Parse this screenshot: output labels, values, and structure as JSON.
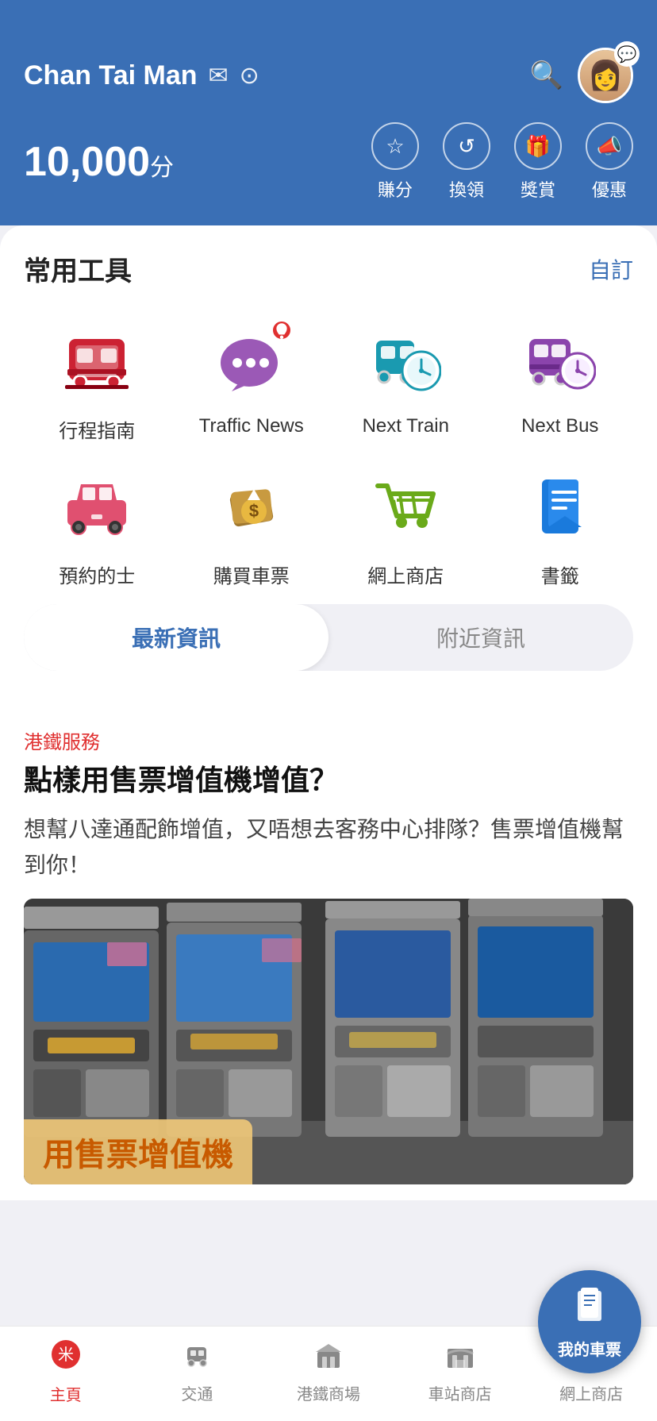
{
  "header": {
    "username": "Chan Tai Man",
    "points": "10,000",
    "points_unit": "分",
    "search_label": "search",
    "avatar_emoji": "👩"
  },
  "quick_actions": [
    {
      "id": "earn",
      "icon": "☆",
      "label": "賺分"
    },
    {
      "id": "redeem",
      "icon": "↺",
      "label": "換領"
    },
    {
      "id": "rewards",
      "icon": "🎁",
      "label": "獎賞"
    },
    {
      "id": "offers",
      "icon": "📣",
      "label": "優惠"
    }
  ],
  "tools_section": {
    "title": "常用工具",
    "customize_label": "自訂"
  },
  "tools": [
    {
      "id": "journey",
      "label": "行程指南",
      "color": "#cc2233"
    },
    {
      "id": "traffic-news",
      "label": "Traffic News",
      "color": "#9b59b6"
    },
    {
      "id": "next-train",
      "label": "Next Train",
      "color": "#1a9ab0"
    },
    {
      "id": "next-bus",
      "label": "Next Bus",
      "color": "#8b44ac"
    },
    {
      "id": "taxi",
      "label": "預約的士",
      "color": "#e05070"
    },
    {
      "id": "buy-ticket",
      "label": "購買車票",
      "color": "#8b6914"
    },
    {
      "id": "online-shop",
      "label": "網上商店",
      "color": "#6aaa1a"
    },
    {
      "id": "bookmarks",
      "label": "書籤",
      "color": "#1a7adc"
    }
  ],
  "tabs": [
    {
      "id": "latest",
      "label": "最新資訊",
      "active": true
    },
    {
      "id": "nearby",
      "label": "附近資訊",
      "active": false
    }
  ],
  "news": {
    "category": "港鐵服務",
    "title": "點樣用售票增值機增值？",
    "description": "想幫八達通配飾增值，又唔想去客務中心排隊？售票增值機幫到你！",
    "image_text": "用售票增值機"
  },
  "bottom_nav": [
    {
      "id": "home",
      "label": "主頁",
      "active": true,
      "icon": "⊗"
    },
    {
      "id": "transport",
      "label": "交通",
      "active": false,
      "icon": "🚇"
    },
    {
      "id": "mtr-mall",
      "label": "港鐵商場",
      "active": false,
      "icon": "🏬"
    },
    {
      "id": "station-shop",
      "label": "車站商店",
      "active": false,
      "icon": "🏪"
    },
    {
      "id": "online-shop",
      "label": "網上商店",
      "active": false,
      "icon": "🛒"
    }
  ],
  "floating_button": {
    "label": "我的車票"
  }
}
